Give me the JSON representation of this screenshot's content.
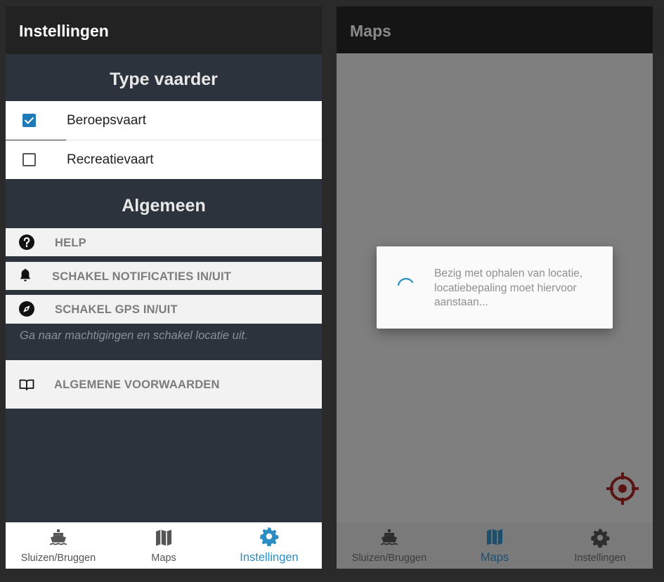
{
  "left": {
    "title": "Instellingen",
    "sections": {
      "type_vaarder": "Type vaarder",
      "algemeen": "Algemeen"
    },
    "options": [
      {
        "label": "Beroepsvaart",
        "checked": true
      },
      {
        "label": "Recreatievaart",
        "checked": false
      }
    ],
    "menu": {
      "help": "HELP",
      "notifications": "SCHAKEL NOTIFICATIES IN/UIT",
      "gps": "SCHAKEL GPS IN/UIT",
      "gps_hint": "Ga naar machtigingen en schakel locatie uit.",
      "terms": "ALGEMENE VOORWAARDEN"
    },
    "nav": {
      "active": "Instellingen",
      "items": [
        "Sluizen/Bruggen",
        "Maps",
        "Instellingen"
      ]
    }
  },
  "right": {
    "title": "Maps",
    "dialog_text": "Bezig met ophalen van locatie, locatiebepaling moet hiervoor aanstaan...",
    "nav": {
      "active": "Maps",
      "items": [
        "Sluizen/Bruggen",
        "Maps",
        "Instellingen"
      ]
    }
  },
  "icons": {
    "help": "question-circle-icon",
    "notifications": "bell-icon",
    "gps": "compass-icon",
    "terms": "open-book-icon",
    "nav_sluizen": "ship-icon",
    "nav_maps": "map-icon",
    "nav_settings": "gear-icon",
    "locate": "crosshair-icon"
  },
  "colors": {
    "accent": "#2a8ec4",
    "checkbox": "#217ab8",
    "settings_bg": "#2d333c",
    "locate_button": "#5a1414"
  }
}
